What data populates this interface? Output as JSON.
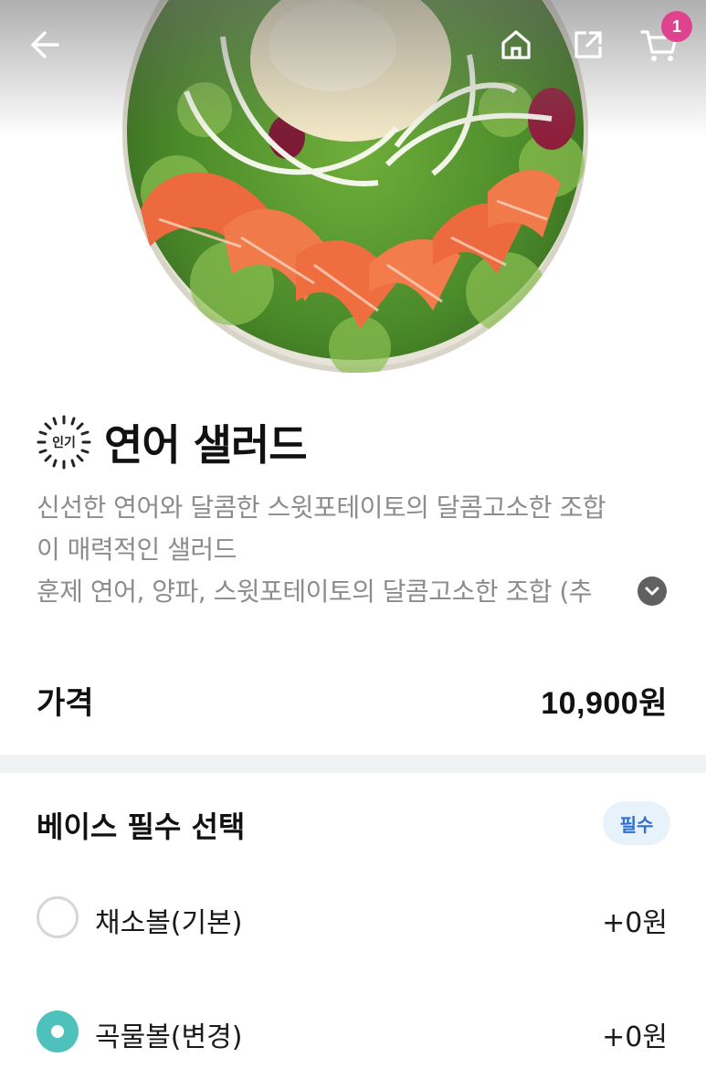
{
  "header": {
    "back_icon": "arrow-left-icon",
    "home_icon": "home-icon",
    "share_icon": "share-icon",
    "cart_icon": "cart-icon",
    "cart_count": "1",
    "badge_color": "#e0428e"
  },
  "product": {
    "popular_badge": "인기",
    "title": "연어 샐러드",
    "description_lines": [
      "신선한 연어와 달콤한 스윗포테이토의 달콤고소한 조합",
      "이 매력적인 샐러드",
      "훈제 연어, 양파, 스윗포테이토의 달콤고소한 조합 (추"
    ],
    "expand_icon": "chevron-down-icon"
  },
  "price": {
    "label": "가격",
    "value": "10,900원"
  },
  "options_section": {
    "title": "베이스 필수 선택",
    "required_label": "필수",
    "required_color": "#2f6fd1",
    "accent_color": "#4fc1bd",
    "options": [
      {
        "label": "채소볼(기본)",
        "price": "+0원",
        "selected": false
      },
      {
        "label": "곡물볼(변경)",
        "price": "+0원",
        "selected": true
      }
    ]
  }
}
